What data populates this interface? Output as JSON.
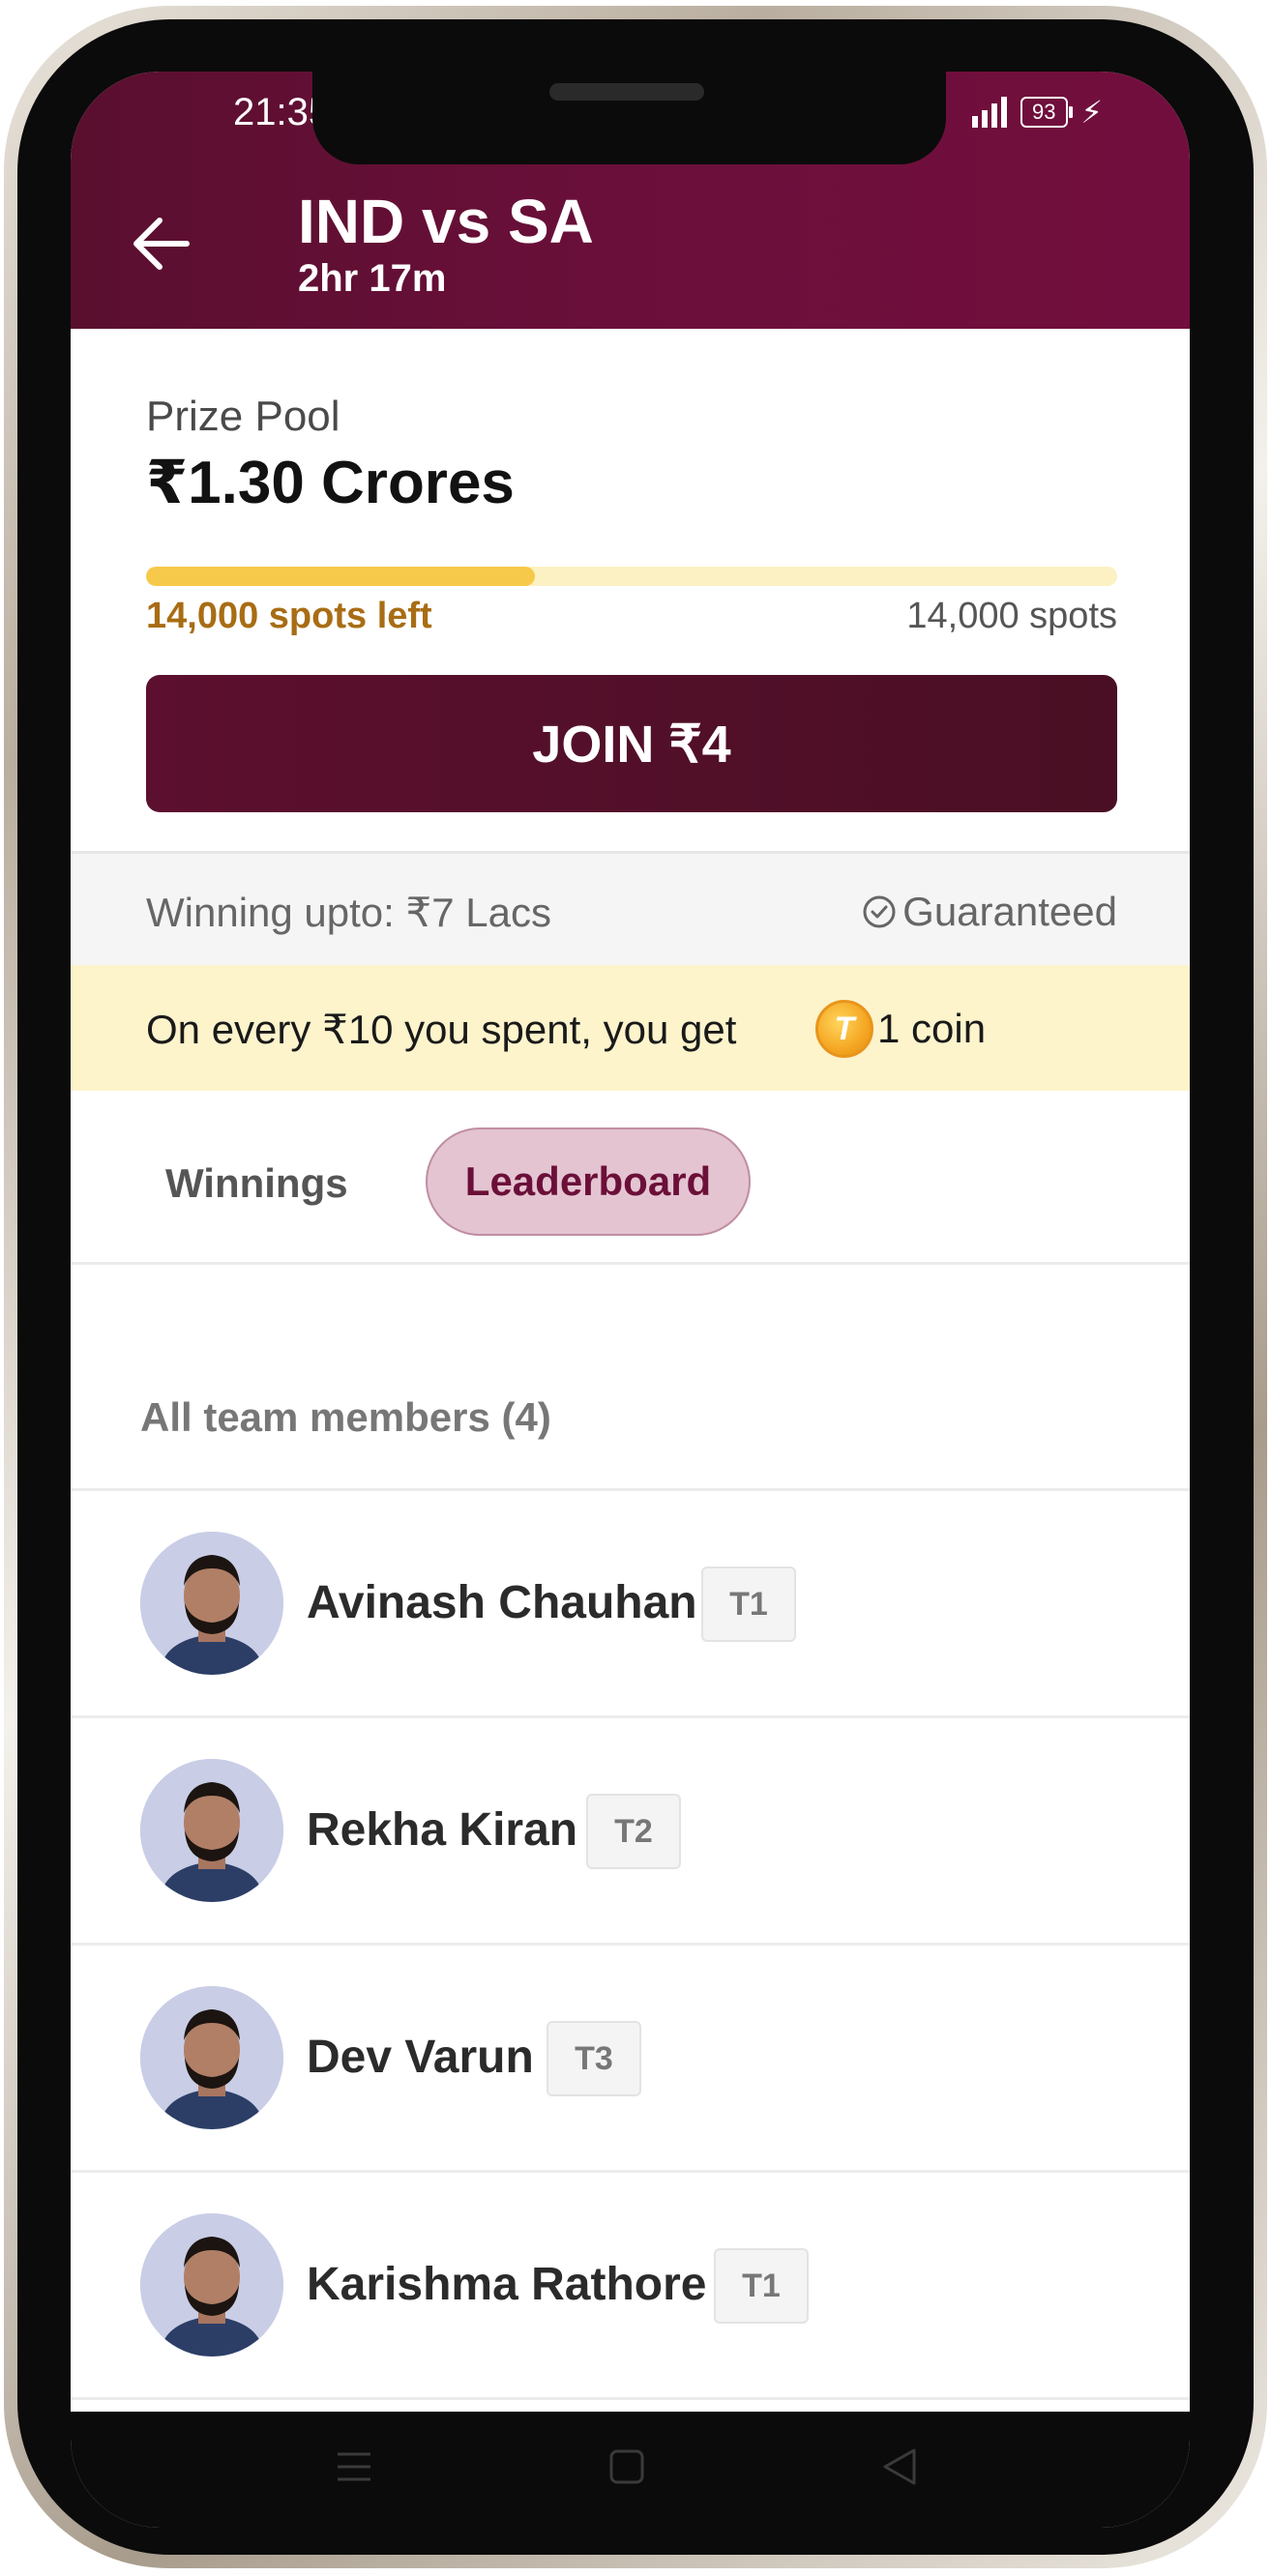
{
  "status_bar": {
    "time": "21:35",
    "battery": "93"
  },
  "header": {
    "title": "IND vs SA",
    "subtitle": "2hr 17m"
  },
  "prize": {
    "label": "Prize Pool",
    "value": "₹1.30 Crores",
    "spots_left": "14,000 spots left",
    "spots_total": "14,000 spots",
    "fill_fraction": 0.4
  },
  "join_button": {
    "label": "JOIN ₹4"
  },
  "winning": {
    "text": "Winning upto: ₹7 Lacs",
    "guaranteed": "Guaranteed"
  },
  "coin_offer": {
    "text": "On every ₹10 you spent, you get",
    "coin_letter": "T",
    "reward": "1 coin"
  },
  "tabs": [
    {
      "label": "Winnings",
      "active": false
    },
    {
      "label": "Leaderboard",
      "active": true
    }
  ],
  "members": {
    "heading": "All team members (4)",
    "items": [
      {
        "name": "Avinash Chauhan",
        "team": "T1"
      },
      {
        "name": "Rekha Kiran",
        "team": "T2"
      },
      {
        "name": "Dev Varun",
        "team": "T3"
      },
      {
        "name": "Karishma Rathore",
        "team": "T1"
      }
    ]
  },
  "colors": {
    "header": "#6c0f3b",
    "accent": "#f7c94a",
    "join": "#5c0f2e",
    "tab_active_bg": "#e4c4d1"
  }
}
